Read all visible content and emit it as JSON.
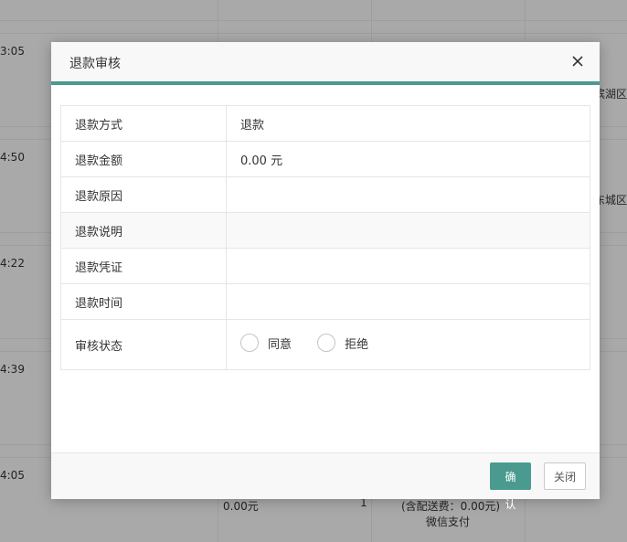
{
  "background": {
    "times": [
      "3:05",
      "4:50",
      "4:22",
      "4:39",
      "4:05"
    ],
    "districts": [
      "滨湖区",
      "东城区"
    ],
    "bottom_row": {
      "amount": "0.00元",
      "qty": "1",
      "delivery": "(含配送费：0.00元)",
      "payment": "微信支付"
    }
  },
  "dialog": {
    "title": "退款审核",
    "rows": [
      {
        "label": "退款方式",
        "value": "退款"
      },
      {
        "label": "退款金额",
        "value": "0.00 元"
      },
      {
        "label": "退款原因",
        "value": ""
      },
      {
        "label": "退款说明",
        "value": ""
      },
      {
        "label": "退款凭证",
        "value": ""
      },
      {
        "label": "退款时间",
        "value": ""
      }
    ],
    "status": {
      "label": "审核状态",
      "options": [
        "同意",
        "拒绝"
      ]
    },
    "buttons": {
      "confirm": "确认",
      "close": "关闭"
    }
  },
  "colors": {
    "accent": "#4a9a8f"
  }
}
